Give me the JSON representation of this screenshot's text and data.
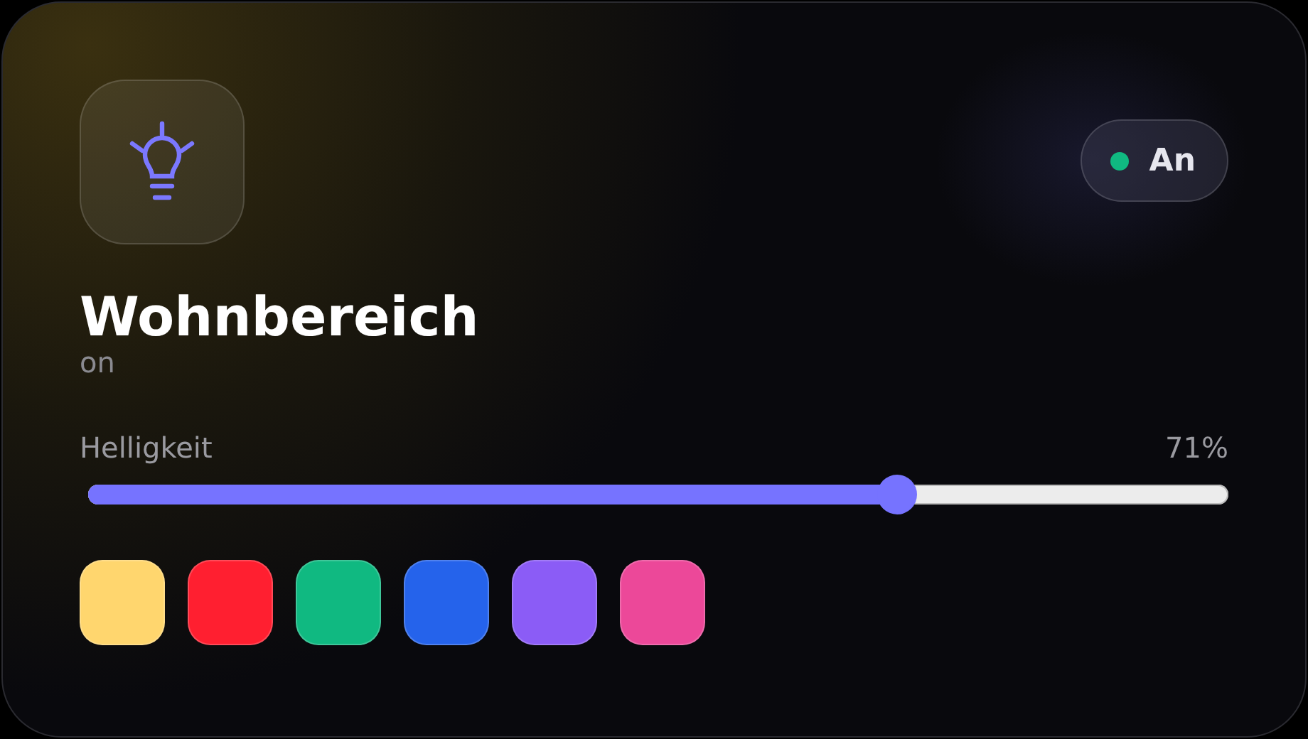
{
  "device": {
    "name": "Wohnbereich",
    "status_text": "on",
    "on": true,
    "toggle_label": "An"
  },
  "brightness": {
    "label": "Helligkeit",
    "reading": "71%",
    "level": 0.71
  },
  "colors": [
    {
      "color": "#ffd66e"
    },
    {
      "color": "#ff1f30"
    },
    {
      "color": "#10b981"
    },
    {
      "color": "#2563eb"
    },
    {
      "color": "#8b5cf6"
    },
    {
      "color": "#ec4899"
    }
  ]
}
